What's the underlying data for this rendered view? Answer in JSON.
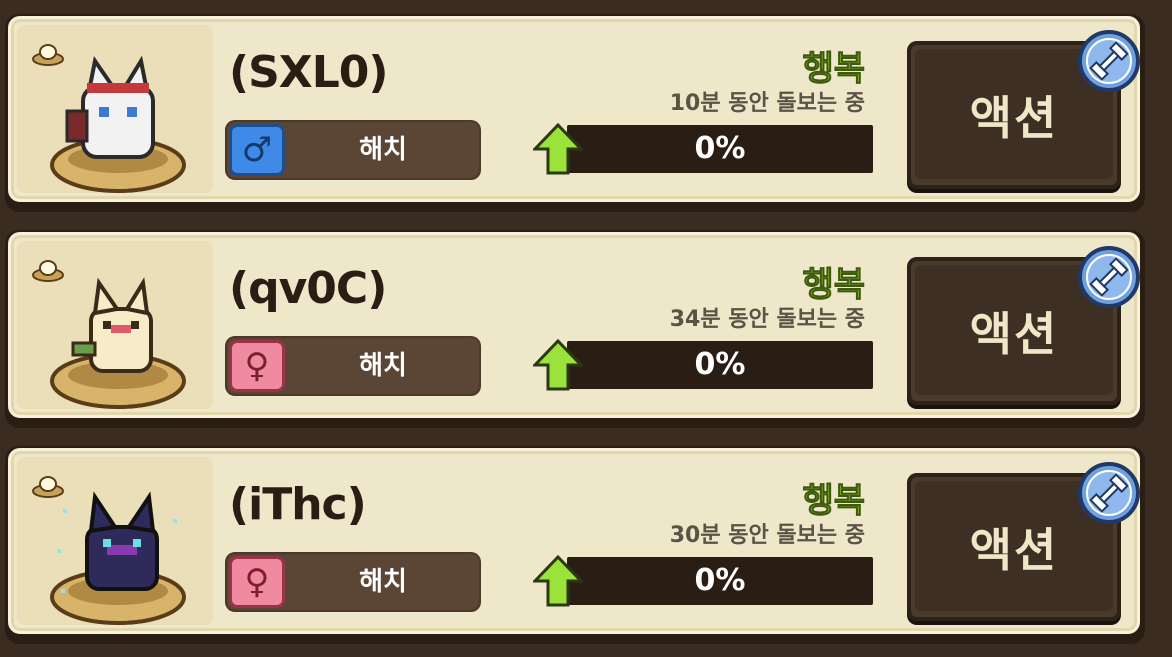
{
  "pets": [
    {
      "name": "(SXL0)",
      "gender": "male",
      "gender_symbol": "♂",
      "status": "해치",
      "mood": "행복",
      "care_time": "10분 동안 돌보는 중",
      "progress_value": 0,
      "progress_text": "0%",
      "action_label": "액션",
      "sprite": "white-red-wolf-pet",
      "badge_icon": "egg-nest-icon"
    },
    {
      "name": "(qv0C)",
      "gender": "female",
      "gender_symbol": "♀",
      "status": "해치",
      "mood": "행복",
      "care_time": "34분 동안 돌보는 중",
      "progress_value": 0,
      "progress_text": "0%",
      "action_label": "액션",
      "sprite": "cream-cat-pet",
      "badge_icon": "egg-nest-icon"
    },
    {
      "name": "(iThc)",
      "gender": "female",
      "gender_symbol": "♀",
      "status": "해치",
      "mood": "행복",
      "care_time": "30분 동안 돌보는 중",
      "progress_value": 0,
      "progress_text": "0%",
      "action_label": "액션",
      "sprite": "dark-purple-cat-pet",
      "badge_icon": "egg-nest-icon"
    }
  ],
  "colors": {
    "mood": "#8ec12a",
    "male": "#3f8ae6",
    "female": "#f08aa0",
    "card": "#efe7c9",
    "button": "#3d2f23"
  }
}
